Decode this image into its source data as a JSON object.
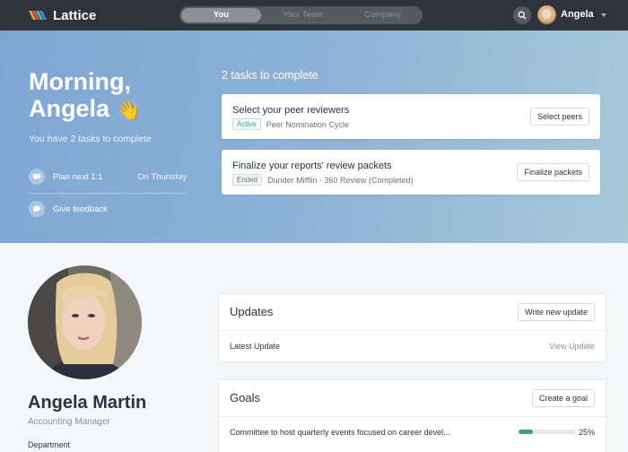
{
  "app": {
    "name": "Lattice"
  },
  "nav": {
    "tabs": [
      "You",
      "Your Team",
      "Company"
    ],
    "user_name": "Angela"
  },
  "hero": {
    "greeting_line1": "Morning,",
    "greeting_line2": "Angela",
    "greeting_emoji": "👋",
    "subtitle": "You have 2 tasks to complete",
    "quick_actions": [
      {
        "label": "Plan next 1:1",
        "meta": "On Thursday",
        "icon": "chat-bubble-icon"
      },
      {
        "label": "Give feedback",
        "meta": "",
        "icon": "feedback-bubble-icon"
      }
    ],
    "tasks_title": "2 tasks to complete",
    "tasks": [
      {
        "title": "Select your peer reviewers",
        "badge": "Active",
        "meta": "Peer Nomination Cycle",
        "button": "Select peers"
      },
      {
        "title": "Finalize your reports' review packets",
        "badge": "Ended",
        "meta": "Dunder Mifflin - 360 Review (Completed)",
        "button": "Finalize packets"
      }
    ]
  },
  "profile": {
    "name": "Angela Martin",
    "role": "Accounting Manager",
    "department_label": "Department"
  },
  "updates": {
    "title": "Updates",
    "button": "Write new update",
    "row_label": "Latest Update",
    "row_link": "View Update"
  },
  "goals": {
    "title": "Goals",
    "button": "Create a goal",
    "items": [
      {
        "text": "Committee to host quarterly events focused on career devel...",
        "progress": 0.25,
        "percent_label": "25%"
      }
    ]
  },
  "colors": {
    "topbar": "#2f343c",
    "accent_green": "#3ea28a",
    "hero_gradient_start": "#7fa5d3",
    "hero_gradient_end": "#a5cad9"
  }
}
